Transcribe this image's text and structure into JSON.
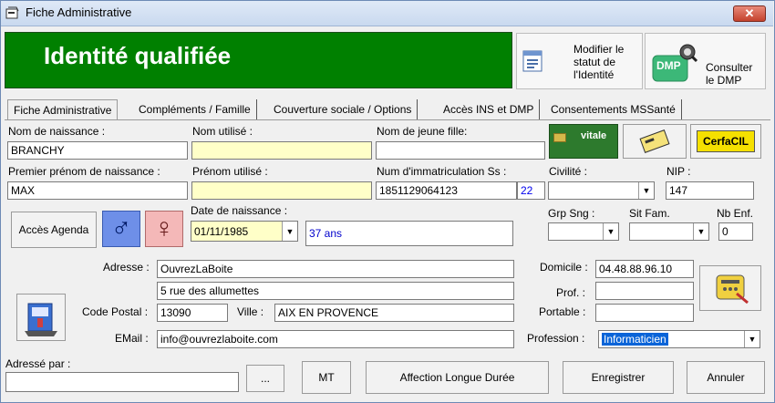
{
  "window": {
    "title": "Fiche Administrative",
    "close_label": "✕"
  },
  "header": {
    "title": "Identité qualifiée"
  },
  "actions": {
    "modify_status": "Modifier le statut de l'Identité",
    "consult_dmp": "Consulter le DMP",
    "dmp_badge": "DMP",
    "vitale_label": "vitale",
    "cerfa_label": "CerfaCIL"
  },
  "tabs": [
    "Fiche Administrative",
    "Compléments / Famille",
    "Couverture sociale / Options",
    "Accès INS et DMP",
    "Consentements MSSanté"
  ],
  "form": {
    "nom_naissance": {
      "label": "Nom de naissance :",
      "value": "BRANCHY"
    },
    "nom_utilise": {
      "label": "Nom utilisé :",
      "value": ""
    },
    "nom_jeune_fille": {
      "label": "Nom de jeune fille:",
      "value": ""
    },
    "premier_prenom": {
      "label": "Premier prénom de naissance :",
      "value": "MAX"
    },
    "prenom_utilise": {
      "label": "Prénom utilisé :",
      "value": ""
    },
    "num_immat": {
      "label": "Num d'immatriculation Ss :",
      "value": "1851129064123",
      "key": "22"
    },
    "civilite": {
      "label": "Civilité :",
      "value": ""
    },
    "nip": {
      "label": "NIP :",
      "value": "147"
    },
    "acces_agenda": "Accès Agenda",
    "male_symbol": "♂",
    "female_symbol": "♀",
    "date_naissance": {
      "label": "Date de naissance :",
      "value": "01/11/1985",
      "age": "37 ans"
    },
    "grp_sng": {
      "label": "Grp Sng :",
      "value": ""
    },
    "sit_fam": {
      "label": "Sit Fam.",
      "value": ""
    },
    "nb_enf": {
      "label": "Nb Enf.",
      "value": "0"
    },
    "adresse": {
      "label": "Adresse :",
      "line1": "OuvrezLaBoite",
      "line2": "5 rue des allumettes"
    },
    "code_postal": {
      "label": "Code Postal :",
      "value": "13090"
    },
    "ville": {
      "label": "Ville :",
      "value": "AIX EN PROVENCE"
    },
    "email": {
      "label": "EMail :",
      "value": "info@ouvrezlaboite.com"
    },
    "domicile": {
      "label": "Domicile :",
      "value": "04.48.88.96.10"
    },
    "prof": {
      "label": "Prof. :",
      "value": ""
    },
    "portable": {
      "label": "Portable :",
      "value": ""
    },
    "profession": {
      "label": "Profession :",
      "value": "Informaticien"
    }
  },
  "footer": {
    "adresse_par_label": "Adressé par :",
    "adresse_par_value": "",
    "browse_label": "...",
    "mt_label": "MT",
    "ald_label": "Affection Longue Durée",
    "save_label": "Enregistrer",
    "cancel_label": "Annuler"
  }
}
